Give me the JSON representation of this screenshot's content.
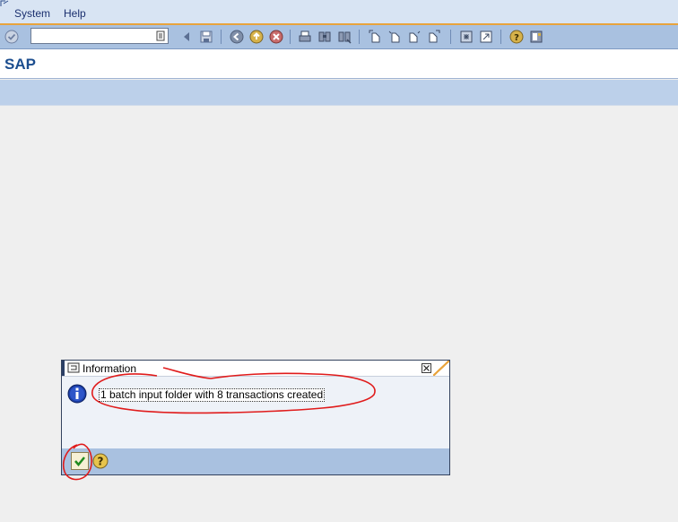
{
  "menubar": {
    "items": [
      {
        "label": "System"
      },
      {
        "label": "Help"
      }
    ]
  },
  "toolbar": {
    "command_field_value": "",
    "icons": [
      "enter-icon",
      "back-icon",
      "save-icon",
      "back-nav-icon",
      "exit-icon",
      "cancel-icon",
      "print-icon",
      "find-icon",
      "find-next-icon",
      "first-page-icon",
      "previous-page-icon",
      "next-page-icon",
      "last-page-icon",
      "create-session-icon",
      "shortcut-icon",
      "help-icon",
      "layout-menu-icon"
    ]
  },
  "title_area": {
    "title": "SAP"
  },
  "dialog": {
    "title": "Information",
    "message": "1 batch input folder with 8 transactions created",
    "buttons": [
      "ok-check-icon",
      "help-icon"
    ]
  },
  "colors": {
    "menu_bg": "#d8e4f3",
    "toolbar_bg": "#a9c1e0",
    "accent_orange": "#e8a33c",
    "title_blue": "#1c4e8f",
    "annotation_red": "#e01b1b"
  }
}
